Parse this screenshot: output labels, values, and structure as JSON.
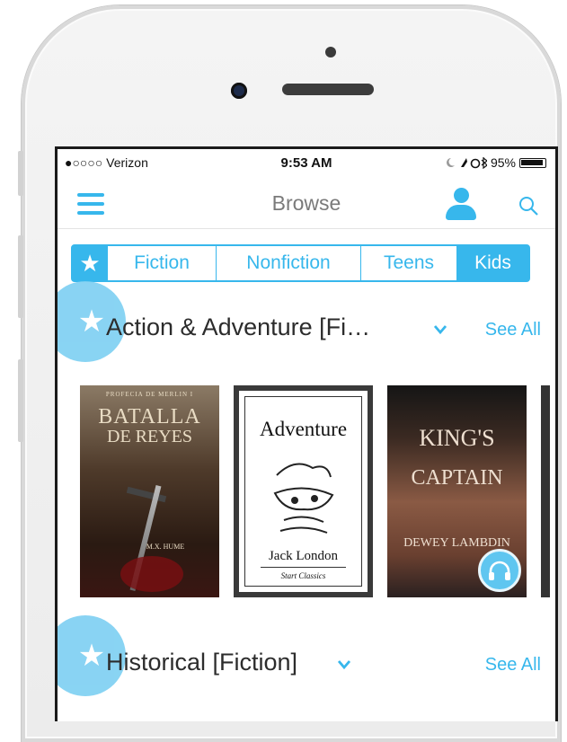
{
  "status_bar": {
    "carrier": "●○○○○ Verizon",
    "time": "9:53 AM",
    "battery": "95%"
  },
  "nav": {
    "title": "Browse"
  },
  "tabs": [
    {
      "label": "Fiction",
      "active": false
    },
    {
      "label": "Nonfiction",
      "active": false
    },
    {
      "label": "Teens",
      "active": false
    },
    {
      "label": "Kids",
      "active": true
    }
  ],
  "sections": [
    {
      "title": "Action & Adventure [Fi…",
      "see_all": "See All",
      "books": [
        {
          "lines": [
            "PROFECIA DE MERLIN I",
            "BATALLA",
            "DE REYES",
            "M.X. HUME"
          ]
        },
        {
          "lines": [
            "Adventure",
            "Jack London",
            "Start Classics"
          ]
        },
        {
          "lines": [
            "KING'S",
            "CAPTAIN",
            "DEWEY LAMBDIN"
          ],
          "audio": true
        }
      ]
    },
    {
      "title": "Historical [Fiction]",
      "see_all": "See All"
    }
  ],
  "colors": {
    "accent": "#37b7ec",
    "accent_light": "#7fd0f2"
  }
}
